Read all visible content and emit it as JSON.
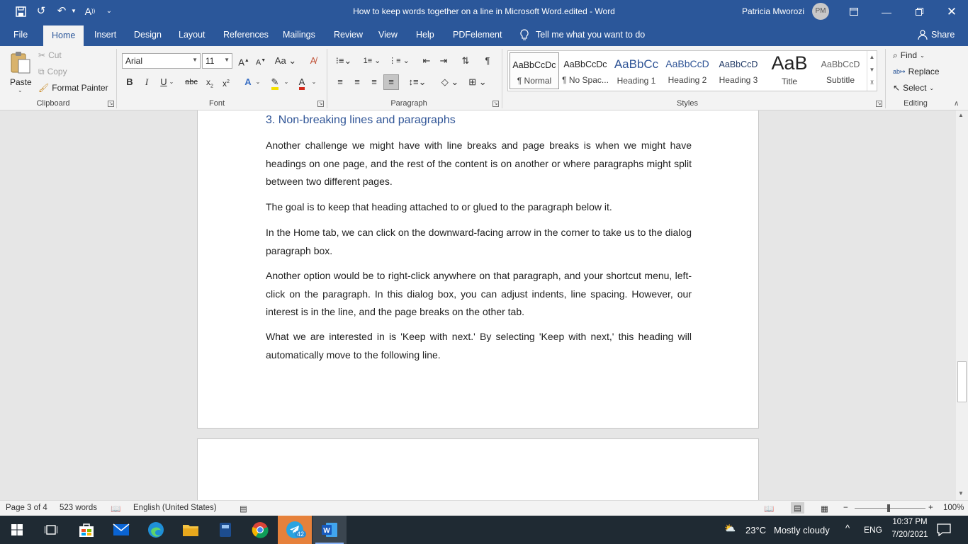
{
  "titlebar": {
    "title": "How to keep words together on a line in Microsoft Word.edited  -  Word",
    "user_name": "Patricia Mworozi",
    "user_initials": "PM"
  },
  "tabs": [
    "File",
    "Home",
    "Insert",
    "Design",
    "Layout",
    "References",
    "Mailings",
    "Review",
    "View",
    "Help",
    "PDFelement"
  ],
  "tell_me": "Tell me what you want to do",
  "share": "Share",
  "clipboard": {
    "paste": "Paste",
    "cut": "Cut",
    "copy": "Copy",
    "format_painter": "Format Painter",
    "label": "Clipboard"
  },
  "font": {
    "family": "Arial",
    "size": "11",
    "label": "Font"
  },
  "paragraph": {
    "label": "Paragraph"
  },
  "styles": {
    "label": "Styles",
    "items": [
      {
        "sample": "AaBbCcDc",
        "name": "¶ Normal"
      },
      {
        "sample": "AaBbCcDc",
        "name": "¶ No Spac..."
      },
      {
        "sample": "AaBbCc",
        "name": "Heading 1"
      },
      {
        "sample": "AaBbCcD",
        "name": "Heading 2"
      },
      {
        "sample": "AaBbCcD",
        "name": "Heading 3"
      },
      {
        "sample": "AaB",
        "name": "Title"
      },
      {
        "sample": "AaBbCcD",
        "name": "Subtitle"
      }
    ]
  },
  "editing": {
    "find": "Find",
    "replace": "Replace",
    "select": "Select",
    "label": "Editing"
  },
  "document": {
    "heading": "3.  Non-breaking lines and paragraphs",
    "paragraphs": [
      "Another challenge we might have with line breaks and page breaks is when we might have headings on one page, and the rest of the content is on another or where paragraphs might split between two different pages.",
      "The goal is to keep that heading attached to or glued to the paragraph below it.",
      "In the Home tab, we can click on the downward-facing arrow in the corner to take us to the dialog paragraph box.",
      "Another option would be to right-click anywhere on that paragraph, and your shortcut menu, left-click on the paragraph. In this dialog box, you can adjust indents, line spacing. However, our interest is in the line, and the page breaks on the other tab.",
      "What we are interested in is 'Keep with next.' By selecting 'Keep with next,' this heading will automatically move to the following line."
    ]
  },
  "status": {
    "page": "Page 3 of 4",
    "words": "523 words",
    "language": "English (United States)",
    "zoom": "100%"
  },
  "taskbar": {
    "weather_temp": "23°C",
    "weather_text": "Mostly cloudy",
    "lang": "ENG",
    "time": "10:37 PM",
    "date": "7/20/2021",
    "telegram_badge": "42"
  },
  "colors": {
    "word_blue": "#2b579a",
    "heading_blue": "#2f5496",
    "taskbar": "#1f2a33"
  }
}
